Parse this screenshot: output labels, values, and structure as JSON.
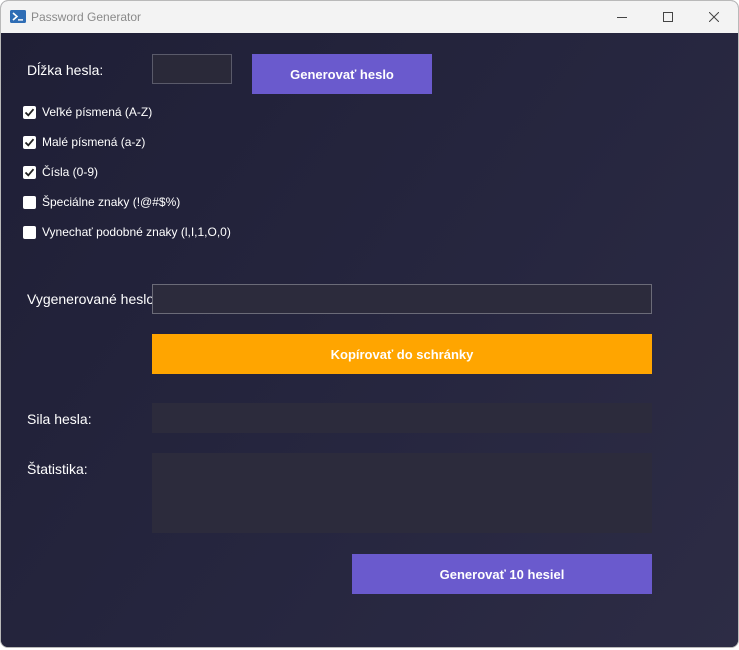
{
  "window": {
    "title": "Password Generator"
  },
  "form": {
    "length_label": "Dĺžka hesla:",
    "length_value": "",
    "generate_button": "Generovať heslo",
    "options": [
      {
        "label": "Veľké písmená (A-Z)",
        "checked": true
      },
      {
        "label": "Malé písmená (a-z)",
        "checked": true
      },
      {
        "label": "Čísla (0-9)",
        "checked": true
      },
      {
        "label": "Špeciálne znaky (!@#$%)",
        "checked": false
      },
      {
        "label": "Vynechať podobné znaky (l,I,1,O,0)",
        "checked": false
      }
    ],
    "generated_label": "Vygenerované heslo",
    "generated_value": "",
    "copy_button": "Kopírovať do schránky",
    "strength_label": "Sila hesla:",
    "strength_value": "",
    "stats_label": "Štatistika:",
    "stats_value": "",
    "generate10_button": "Generovať 10 hesiel"
  },
  "colors": {
    "accent_purple": "#6a5acd",
    "accent_orange": "#ffa500",
    "background": "#232238",
    "field": "#2c2b3c"
  }
}
